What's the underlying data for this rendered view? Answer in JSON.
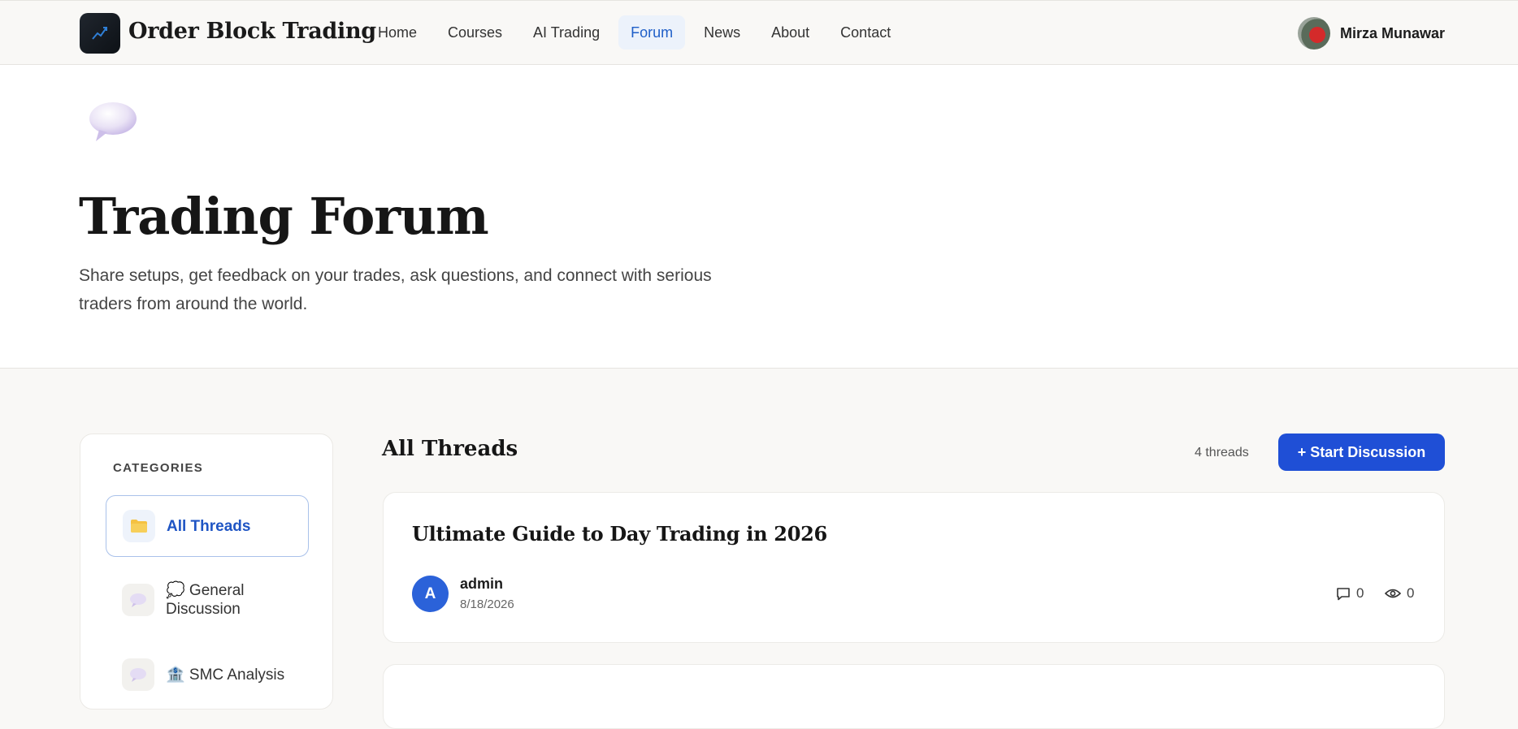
{
  "nav": {
    "brand": "Order Block Trading",
    "items": [
      {
        "label": "Home"
      },
      {
        "label": "Courses"
      },
      {
        "label": "AI Trading"
      },
      {
        "label": "Forum",
        "active": true
      },
      {
        "label": "News"
      },
      {
        "label": "About"
      },
      {
        "label": "Contact"
      }
    ],
    "user_name": "Mirza Munawar"
  },
  "hero": {
    "icon": "speech-bubble-icon",
    "title": "Trading Forum",
    "subtitle": "Share setups, get feedback on your trades, ask questions, and connect with serious traders from around the world."
  },
  "sidebar": {
    "heading": "CATEGORIES",
    "items": [
      {
        "label": "All Threads",
        "icon": "folder-icon",
        "active": true
      },
      {
        "label": "💭 General Discussion",
        "icon": "speech-bubble-icon"
      },
      {
        "label": "🏦 SMC Analysis",
        "icon": "speech-bubble-icon"
      }
    ]
  },
  "threads": {
    "title": "All Threads",
    "count": "4 threads",
    "start_button": "+ Start Discussion",
    "list": [
      {
        "title": "Ultimate Guide to Day Trading in 2026",
        "author_initial": "A",
        "author": "admin",
        "date": "8/18/2026",
        "comments": "0",
        "views": "0"
      }
    ]
  },
  "colors": {
    "accent": "#1f4fd6",
    "active_nav_bg": "#ecf2fb",
    "active_nav_text": "#1f5fc8",
    "page_bg": "#f9f8f6"
  }
}
